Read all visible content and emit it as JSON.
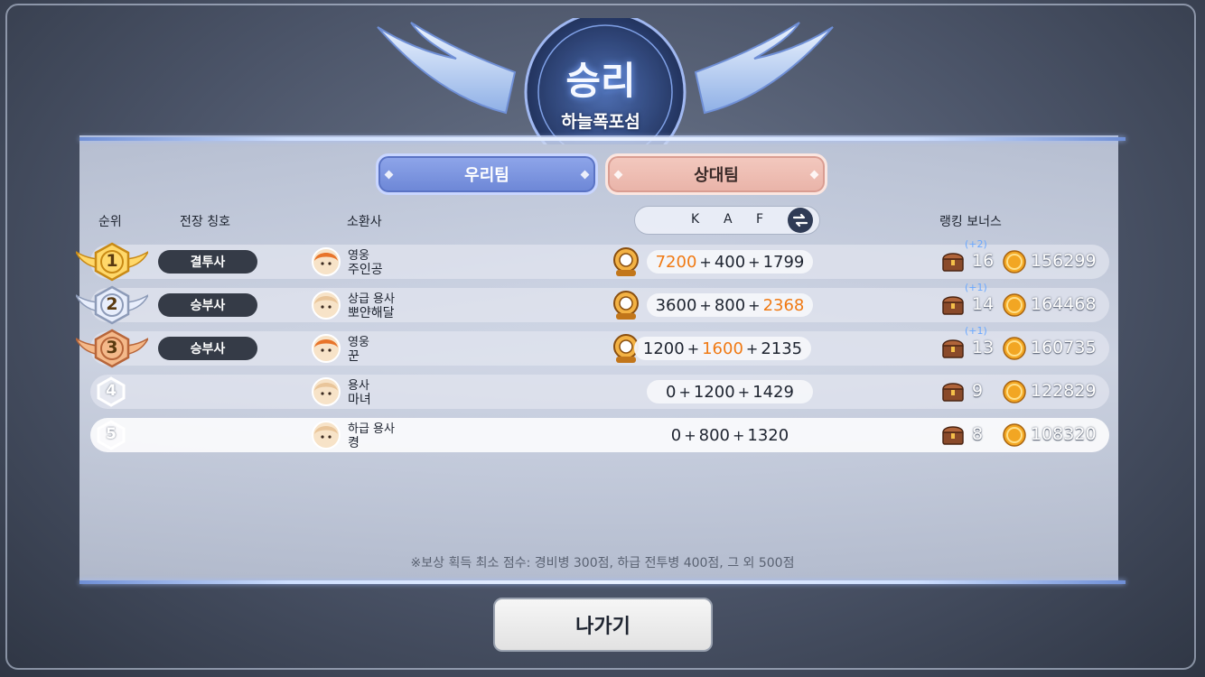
{
  "header": {
    "title": "승리",
    "map_name": "하늘폭포섬"
  },
  "tabs": [
    {
      "label": "우리팀",
      "selected": false
    },
    {
      "label": "상대팀",
      "selected": true
    }
  ],
  "columns": {
    "rank": "순위",
    "battle_title": "전장 칭호",
    "summoner": "소환사",
    "kaf": [
      "K",
      "A",
      "F"
    ],
    "ranking_bonus": "랭킹 보너스"
  },
  "rows": [
    {
      "rank": "1",
      "medal": "gold",
      "battle_title": "결투사",
      "grade": "영웅",
      "name": "주인공",
      "mvp_icon": "trident-mvp-icon",
      "k": "7200",
      "a": "400",
      "f": "1799",
      "highlight": "k",
      "bonus_plus": "(+2)",
      "bonus": "16",
      "gold": "156299"
    },
    {
      "rank": "2",
      "medal": "silver",
      "battle_title": "승부사",
      "grade": "상급 용사",
      "name": "뽀얀해달",
      "mvp_icon": "skull-mvp-icon",
      "k": "3600",
      "a": "800",
      "f": "2368",
      "highlight": "f",
      "bonus_plus": "(+1)",
      "bonus": "14",
      "gold": "164468"
    },
    {
      "rank": "3",
      "medal": "bronze",
      "battle_title": "승부사",
      "grade": "영웅",
      "name": "꾼",
      "mvp_icon": "crown-mvp-icon",
      "k": "1200",
      "a": "1600",
      "f": "2135",
      "highlight": "a",
      "bonus_plus": "(+1)",
      "bonus": "13",
      "gold": "160735"
    },
    {
      "rank": "4",
      "medal": "none",
      "battle_title": "",
      "grade": "용사",
      "name": "마녀",
      "mvp_icon": "",
      "k": "0",
      "a": "1200",
      "f": "1429",
      "highlight": "",
      "bonus_plus": "",
      "bonus": "9",
      "gold": "122829"
    },
    {
      "rank": "5",
      "medal": "none",
      "battle_title": "",
      "grade": "하급 용사",
      "name": "켱",
      "mvp_icon": "",
      "k": "0",
      "a": "800",
      "f": "1320",
      "highlight": "",
      "bonus_plus": "",
      "bonus": "8",
      "gold": "108320"
    }
  ],
  "note": "※보상 획득 최소 점수: 경비병 300점, 하급 전투병 400점, 그 외 500점",
  "exit_button": "나가기",
  "colors": {
    "highlight_orange": "#f07a14",
    "tab_ours": "#7d95e0",
    "tab_theirs": "#efbfb4",
    "badge_dark": "#353b47"
  }
}
